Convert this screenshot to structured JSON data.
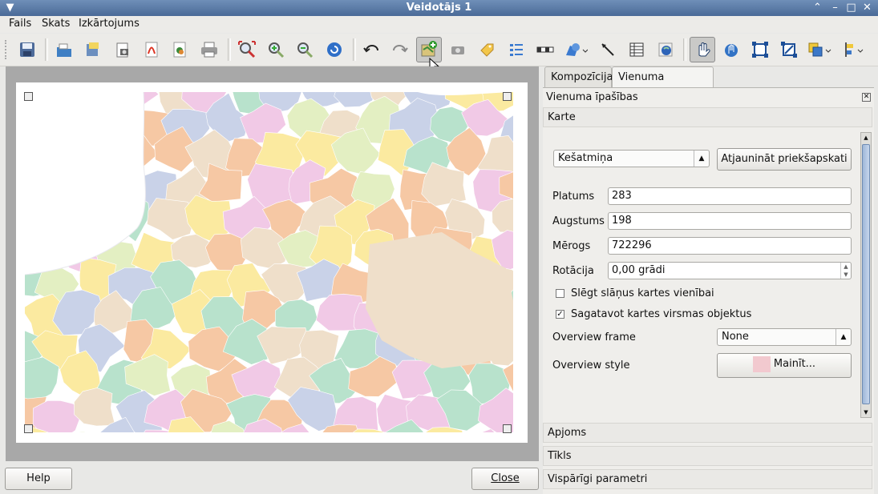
{
  "window": {
    "title": "Veidotājs 1"
  },
  "menu": {
    "items": [
      "Fails",
      "Skats",
      "Izkārtojums"
    ]
  },
  "tabs": [
    {
      "label": "Kompozīcija"
    },
    {
      "label": "Vienuma īpašības"
    }
  ],
  "panel": {
    "header": "Vienuma īpašības",
    "section_map": "Karte",
    "preview_mode": "Kešatmiņa",
    "refresh_button": "Atjaunināt priekšapskati",
    "width_label": "Platums",
    "width_value": "283",
    "height_label": "Augstums",
    "height_value": "198",
    "scale_label": "Mērogs",
    "scale_value": "722296",
    "rotation_label": "Rotācija",
    "rotation_value": "0,00 grādi",
    "lock_layers_label": "Slēgt slāņus kartes vienībai",
    "lock_layers_checked": false,
    "draw_canvas_label": "Sagatavot kartes virsmas objektus",
    "draw_canvas_checked": true,
    "overview_frame_label": "Overview frame",
    "overview_frame_value": "None",
    "overview_style_label": "Overview style",
    "overview_style_button": "Mainīt...",
    "overview_style_color": "#f2c9cf",
    "section_extent": "Apjoms",
    "section_grid": "Tīkls",
    "section_general": "Vispārīgi parametri"
  },
  "footer": {
    "help": "Help",
    "close": "Close"
  },
  "toolbar_icons": [
    "save-icon",
    "new-composer-icon",
    "duplicate-composer-icon",
    "export-image-icon",
    "export-pdf-icon",
    "export-svg-icon",
    "print-icon",
    "zoom-full-icon",
    "zoom-in-icon",
    "zoom-out-icon",
    "refresh-icon",
    "undo-icon",
    "redo-icon",
    "add-map-icon",
    "add-image-icon",
    "add-label-icon",
    "add-legend-icon",
    "add-scalebar-icon",
    "add-shape-icon",
    "add-arrow-icon",
    "add-table-icon",
    "add-html-icon",
    "select-move-icon",
    "move-content-icon",
    "group-icon",
    "ungroup-icon",
    "raise-lower-icon",
    "align-icon"
  ],
  "map_colors": [
    "#c9d2e8",
    "#f6c8a4",
    "#fbeaa0",
    "#b8e2cc",
    "#f1c9e6",
    "#e3efc2",
    "#efdfca"
  ]
}
